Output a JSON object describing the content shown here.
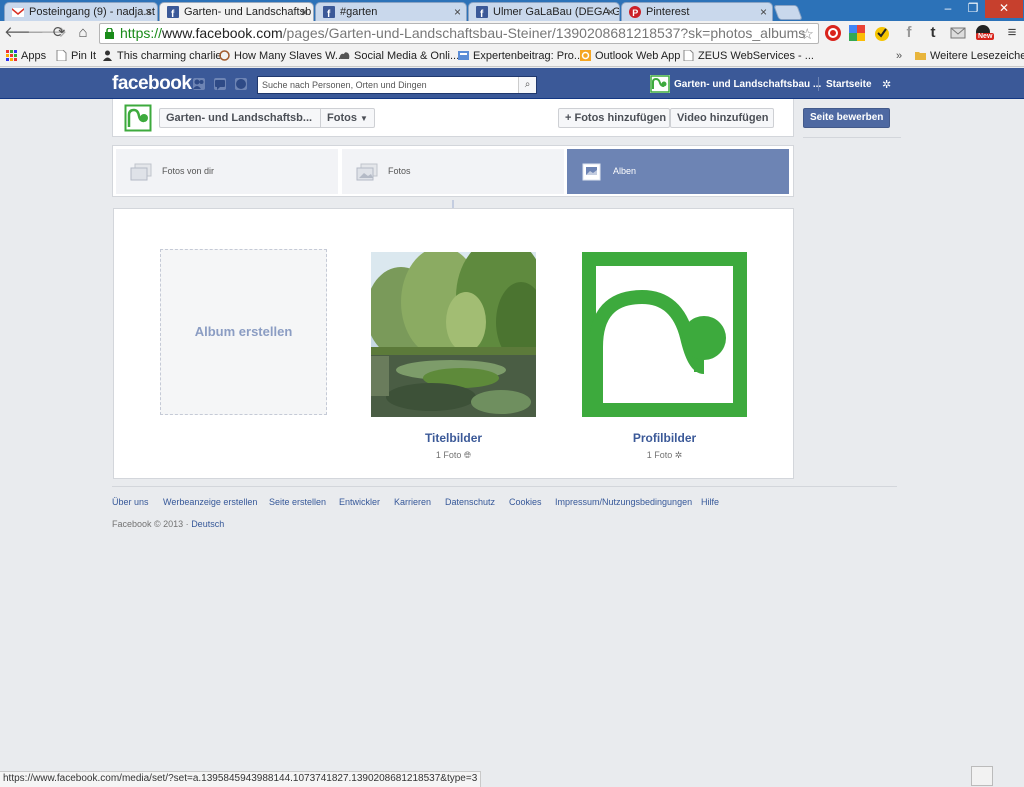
{
  "browser": {
    "tabs": [
      {
        "label": "Posteingang (9) - nadja.st",
        "icon": "gmail-icon"
      },
      {
        "label": "Garten- und Landschaftsb",
        "icon": "facebook-icon",
        "active": true
      },
      {
        "label": "#garten",
        "icon": "facebook-icon"
      },
      {
        "label": "Ulmer GaLaBau (DEGA GA",
        "icon": "facebook-icon"
      },
      {
        "label": "Pinterest",
        "icon": "pinterest-icon"
      }
    ],
    "tab_close": "×",
    "window_buttons": {
      "minimize": "–",
      "maximize": "❐",
      "close": "✕"
    },
    "url": {
      "scheme": "https://",
      "host": "www.facebook.com",
      "path": "/pages/Garten-und-Landschaftsbau-Steiner/139020868121853​7?sk=photos_albums"
    },
    "bookmarks": [
      {
        "label": "Apps",
        "icon": "apps-grid-icon"
      },
      {
        "label": "Pin It",
        "icon": "page-icon"
      },
      {
        "label": "This charming charlie",
        "icon": "person-icon"
      },
      {
        "label": "How Many Slaves W...",
        "icon": "circle-icon"
      },
      {
        "label": "Social Media & Onli...",
        "icon": "cloud-icon"
      },
      {
        "label": "Expertenbeitrag: Pro...",
        "icon": "blog-icon"
      },
      {
        "label": "Outlook Web App",
        "icon": "outlook-icon"
      },
      {
        "label": "ZEUS WebServices - ...",
        "icon": "page-icon"
      }
    ],
    "bookmarks_more": "»",
    "other_bookmarks": "Weitere Lesezeichen",
    "status_url": "https://www.facebook.com/media/set/?set=a.1395845943988144.1073741827.1390208681218537&type=3",
    "ext_badge": "New"
  },
  "facebook": {
    "logo": "facebook",
    "search_placeholder": "Suche nach Personen, Orten und Dingen",
    "page_link": "Garten- und Landschaftsbau ...",
    "home": "Startseite",
    "page_name": "Garten- und Landschaftsb...",
    "photos_dropdown": "Fotos",
    "add_photos": "+ Fotos hinzufügen",
    "add_video": "Video hinzufügen",
    "promote_page": "Seite bewerben",
    "filters": [
      {
        "label": "Fotos von dir"
      },
      {
        "label": "Fotos"
      },
      {
        "label": "Alben",
        "selected": true
      }
    ],
    "create_album": "Album erstellen",
    "albums": [
      {
        "title": "Titelbilder",
        "count": "1 Foto",
        "privacy_icon": "globe-icon"
      },
      {
        "title": "Profilbilder",
        "count": "1 Foto",
        "privacy_icon": "gear-icon"
      }
    ],
    "footer_links": [
      "Über uns",
      "Werbeanzeige erstellen",
      "Seite erstellen",
      "Entwickler",
      "Karrieren",
      "Datenschutz",
      "Cookies",
      "Impressum/Nutzungsbedingungen",
      "Hilfe"
    ],
    "copyright": "Facebook © 2013 · ",
    "language": "Deutsch"
  },
  "colors": {
    "fb_blue": "#3b5998",
    "logo_green": "#3daa3d",
    "selected_tab": "#6d84b4"
  }
}
